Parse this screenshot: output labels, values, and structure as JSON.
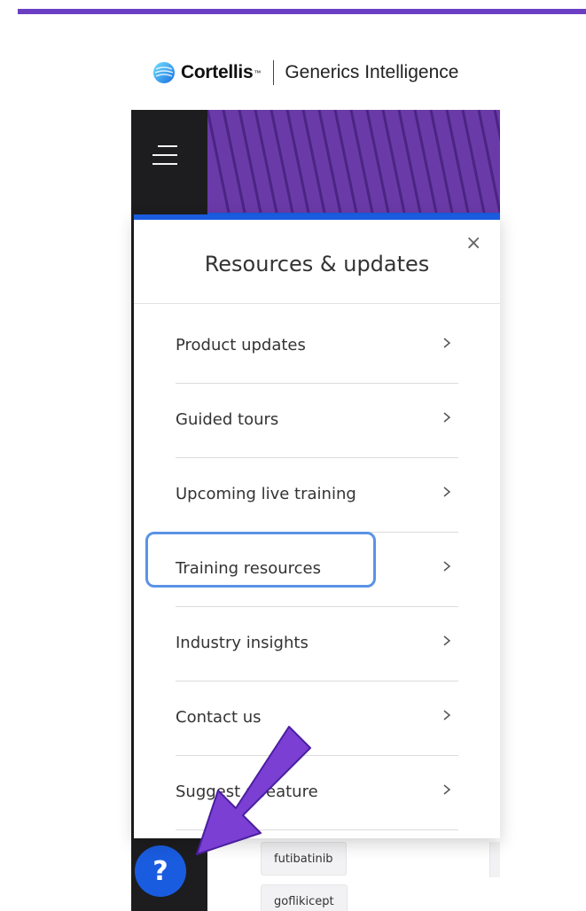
{
  "brand": {
    "name": "Cortellis",
    "tm": "™",
    "product": "Generics Intelligence"
  },
  "panel": {
    "title": "Resources & updates",
    "close": "×",
    "items": [
      {
        "label": "Product updates"
      },
      {
        "label": "Guided tours"
      },
      {
        "label": "Upcoming live training"
      },
      {
        "label": "Training resources"
      },
      {
        "label": "Industry insights"
      },
      {
        "label": "Contact us"
      },
      {
        "label": "Suggest a feature"
      }
    ]
  },
  "background": {
    "chips": [
      "futibatinib",
      "goflikicept"
    ]
  },
  "help": {
    "label": "?"
  },
  "colors": {
    "accent": "#1a5ce0",
    "topbar": "#6a3fc3",
    "annotation_arrow": "#7b3fd4",
    "highlight": "#5b93e6"
  },
  "icons": {
    "menu": "hamburger-icon",
    "close": "close-icon",
    "chevron": "chevron-right-icon",
    "help": "question-icon",
    "logo": "cortellis-logo-icon"
  }
}
